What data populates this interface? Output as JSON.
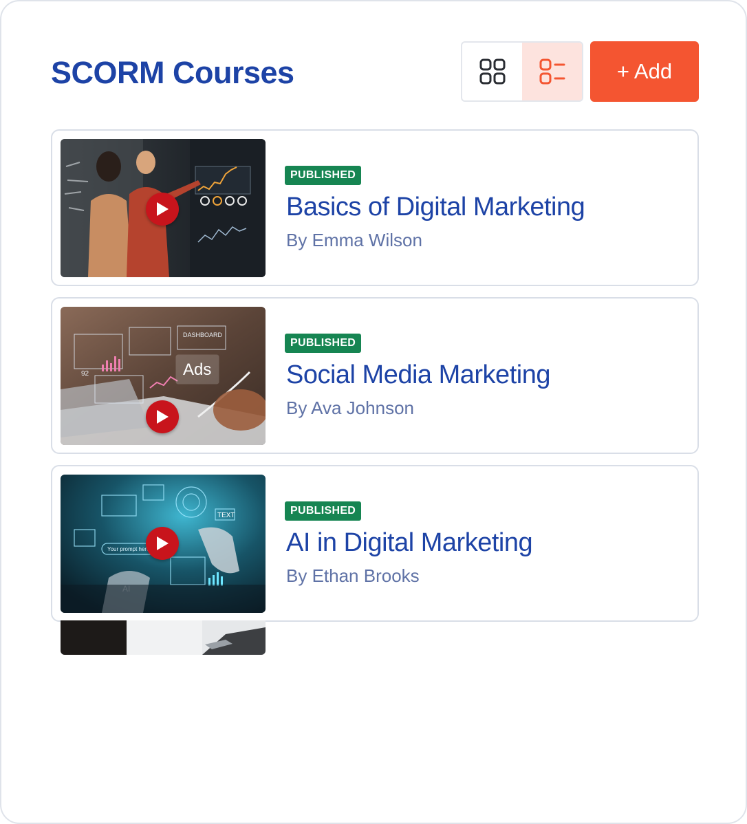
{
  "header": {
    "title": "SCORM Courses",
    "add_label": "+ Add",
    "view_modes": [
      {
        "name": "grid-view",
        "icon": "grid-icon",
        "active": false
      },
      {
        "name": "list-view",
        "icon": "list-icon",
        "active": true
      }
    ]
  },
  "courses": [
    {
      "status": "PUBLISHED",
      "title": "Basics of Digital Marketing",
      "author": "By Emma Wilson",
      "thumbnail": "analysis-presentation-photo"
    },
    {
      "status": "PUBLISHED",
      "title": "Social Media Marketing",
      "author": "By Ava Johnson",
      "thumbnail": "ads-dashboard-photo"
    },
    {
      "status": "PUBLISHED",
      "title": "AI in Digital Marketing",
      "author": "By Ethan Brooks",
      "thumbnail": "ai-robot-hand-photo"
    }
  ],
  "colors": {
    "brand_blue": "#1d43a6",
    "accent_orange": "#f45531",
    "published_green": "#168552",
    "play_red": "#c8141c"
  }
}
